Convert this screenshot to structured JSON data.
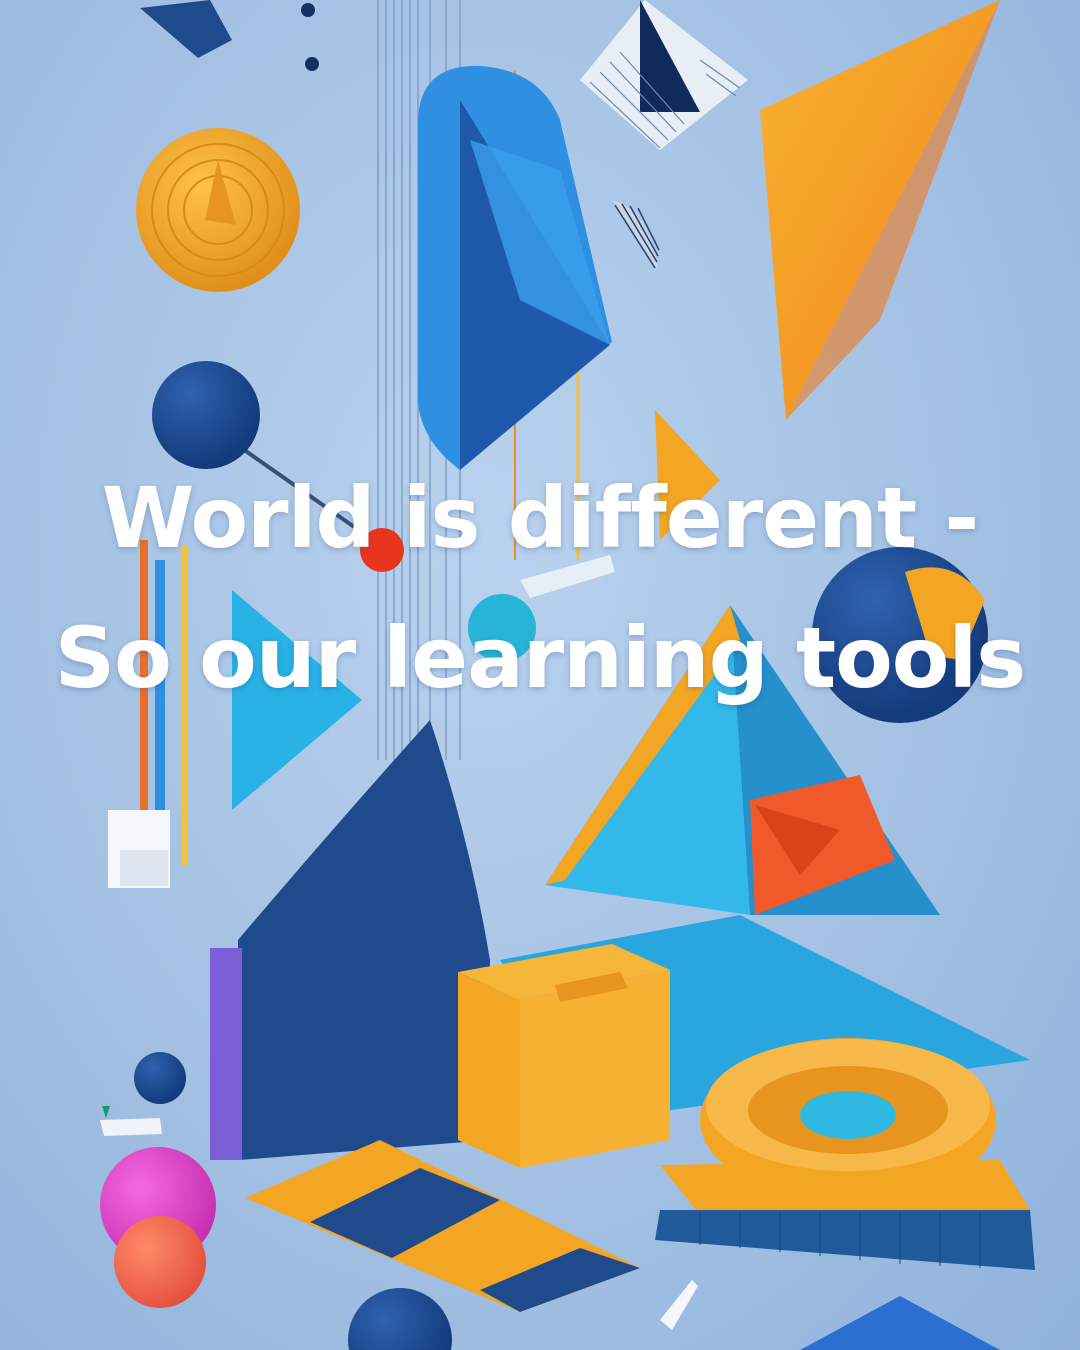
{
  "poster": {
    "headline_line1": "World is different -",
    "headline_line2": "So our learning tools"
  },
  "colors": {
    "background": "#a9c6e6",
    "orange": "#f2a623",
    "deep_orange": "#f07a1e",
    "navy": "#1f4a8c",
    "sky_blue": "#2fa8e0",
    "royal_blue": "#2b6fd0",
    "magenta": "#e040c8",
    "coral": "#f0604a",
    "purple": "#7b5fd6",
    "text": "#ffffff"
  }
}
